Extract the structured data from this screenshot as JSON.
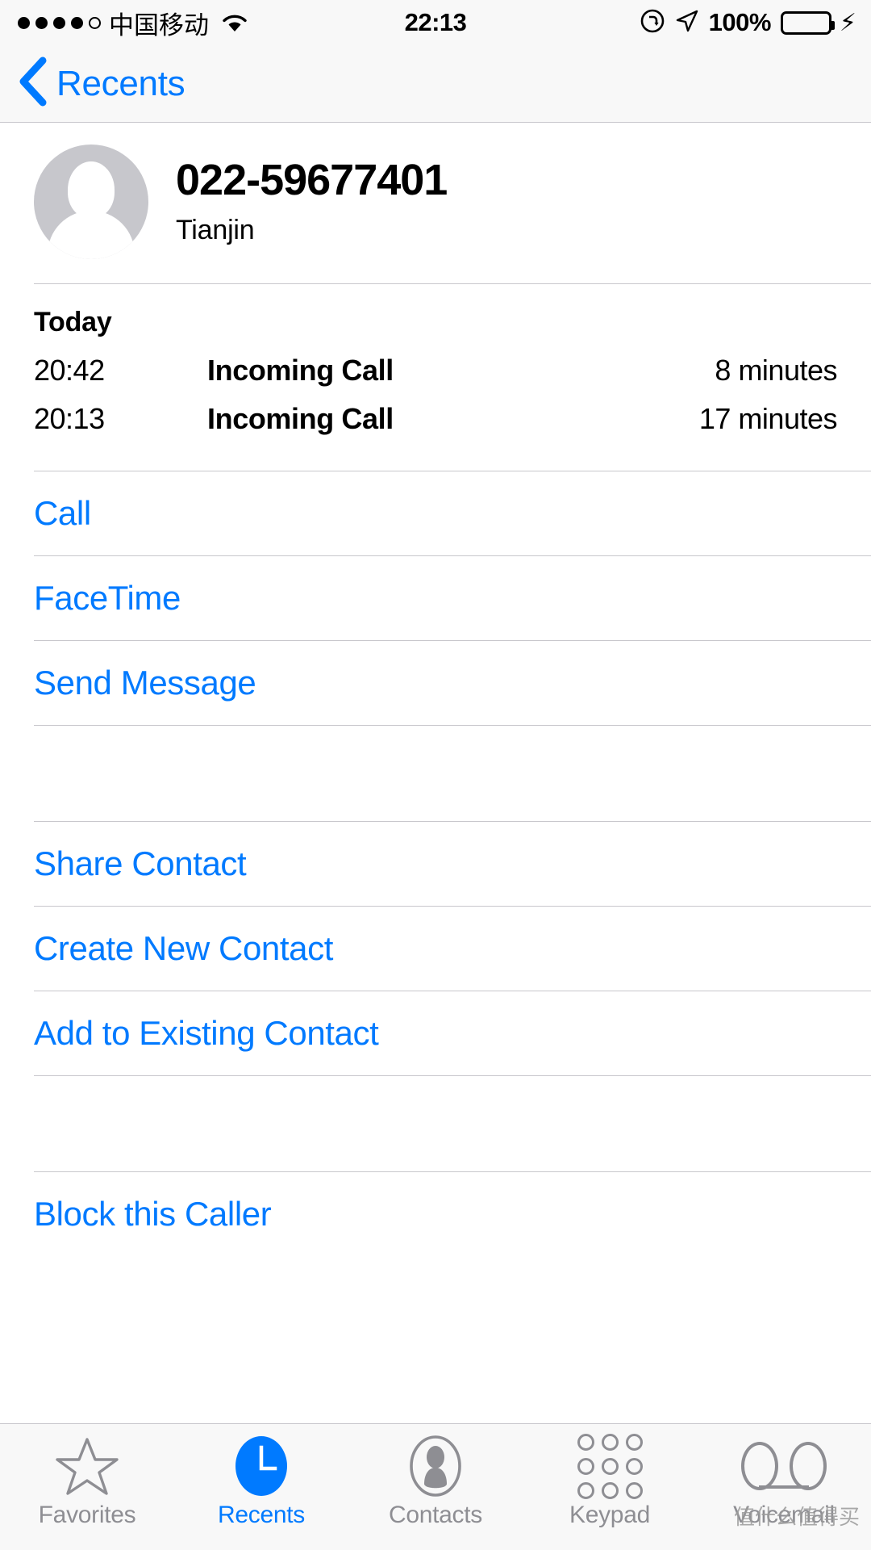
{
  "status_bar": {
    "signal_dots_filled": 4,
    "signal_dots_total": 5,
    "carrier": "中国移动",
    "wifi_icon": "wifi-icon",
    "time": "22:13",
    "rotation_lock_icon": "rotation-lock-icon",
    "location_icon": "location-arrow-icon",
    "battery_percent": "100%",
    "battery_color": "#4cd964",
    "charging_icon": "lightning-bolt-icon"
  },
  "nav_bar": {
    "back_icon": "chevron-left-icon",
    "back_label": "Recents"
  },
  "contact": {
    "avatar_icon": "person-placeholder-avatar",
    "phone_number": "022-59677401",
    "location": "Tianjin"
  },
  "call_history": {
    "section_header": "Today",
    "columns": [
      "time",
      "type",
      "duration"
    ],
    "rows": [
      {
        "time": "20:42",
        "type": "Incoming Call",
        "duration": "8 minutes"
      },
      {
        "time": "20:13",
        "type": "Incoming Call",
        "duration": "17 minutes"
      }
    ]
  },
  "actions_primary": [
    {
      "label": "Call"
    },
    {
      "label": "FaceTime"
    },
    {
      "label": "Send Message"
    }
  ],
  "actions_contact": [
    {
      "label": "Share Contact"
    },
    {
      "label": "Create New Contact"
    },
    {
      "label": "Add to Existing Contact"
    }
  ],
  "actions_block": [
    {
      "label": "Block this Caller"
    }
  ],
  "tab_bar": {
    "items": [
      {
        "label": "Favorites",
        "icon": "star-outline-icon",
        "active": false
      },
      {
        "label": "Recents",
        "icon": "clock-filled-icon",
        "active": true
      },
      {
        "label": "Contacts",
        "icon": "person-circle-icon",
        "active": false
      },
      {
        "label": "Keypad",
        "icon": "keypad-grid-icon",
        "active": false
      },
      {
        "label": "Voicemail",
        "icon": "voicemail-icon",
        "active": false
      }
    ]
  },
  "watermark": {
    "text": "值什么值得买"
  },
  "colors": {
    "accent": "#007aff",
    "separator": "#c8c7cc",
    "inactive": "#8e8e93",
    "battery": "#4cd964"
  }
}
